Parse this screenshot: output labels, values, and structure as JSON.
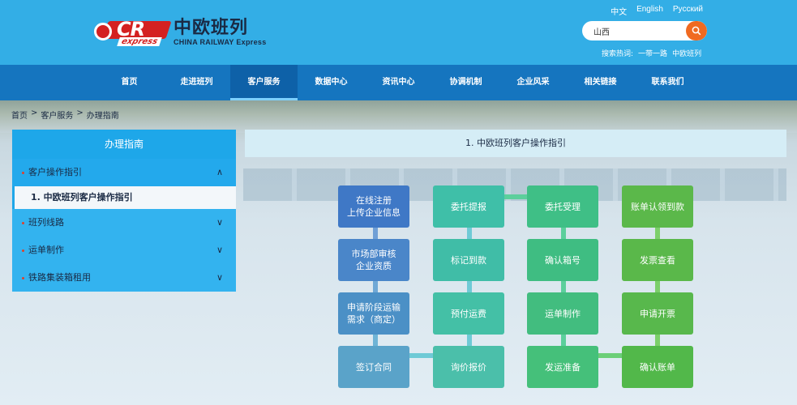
{
  "logo": {
    "cr": "CR",
    "express": "express",
    "cn": "中欧班列",
    "en": "CHINA RAILWAY Express"
  },
  "langs": [
    "中文",
    "English",
    "Русский"
  ],
  "search": {
    "value": "山西"
  },
  "hot": {
    "label": "搜索热词:",
    "terms": [
      "一带一路",
      "中欧班列"
    ]
  },
  "nav": [
    "首页",
    "走进班列",
    "客户服务",
    "数据中心",
    "资讯中心",
    "协调机制",
    "企业风采",
    "相关链接",
    "联系我们"
  ],
  "breadcrumb": [
    "首页",
    ">",
    "客户服务",
    ">",
    "办理指南"
  ],
  "sidebar": {
    "title": "办理指南",
    "groups": [
      {
        "label": "客户操作指引",
        "chevron": "∧"
      },
      {
        "label": "班列线路",
        "chevron": "∨"
      },
      {
        "label": "运单制作",
        "chevron": "∨"
      },
      {
        "label": "铁路集装箱租用",
        "chevron": "∨"
      }
    ],
    "sub": "1. 中欧班列客户操作指引"
  },
  "content": {
    "title": "1. 中欧班列客户操作指引"
  },
  "flow": {
    "col1": [
      "在线注册\n上传企业信息",
      "市场部审核\n企业资质",
      "申请阶段运输\n需求（商定）",
      "签订合同"
    ],
    "col2": [
      "委托提报",
      "标记到款",
      "预付运费",
      "询价报价"
    ],
    "col3": [
      "委托受理",
      "确认箱号",
      "运单制作",
      "发运准备"
    ],
    "col4": [
      "账单认领到款",
      "发票查看",
      "申请开票",
      "确认账单"
    ]
  },
  "colors": {
    "col1": [
      "#3f78c6",
      "#4a86c9",
      "#4b90c6",
      "#5aa3c9"
    ],
    "col2": [
      "#3fbfa8",
      "#40bda7",
      "#44c0a6",
      "#4bbfaa"
    ],
    "col3": [
      "#3fbf86",
      "#3fbd82",
      "#42bd7f",
      "#45c07a"
    ],
    "col4": [
      "#5bb84a",
      "#5ab84a",
      "#58b84c",
      "#52b84a"
    ]
  }
}
